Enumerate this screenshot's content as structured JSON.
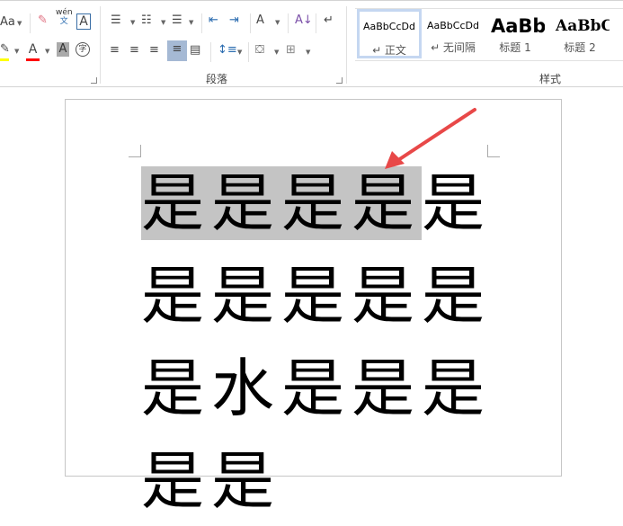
{
  "ribbon": {
    "font_group": {
      "change_case": "Aa",
      "phonetic_top": "wén",
      "phonetic_bottom": "文",
      "char_border": "A",
      "font_color": "A",
      "char_shading": "A",
      "enclose_char": "字"
    },
    "paragraph_group": {
      "label": "段落"
    },
    "styles_group": {
      "label": "样式",
      "items": [
        {
          "preview": "AaBbCcDd",
          "name": "↵ 正文",
          "selected": true
        },
        {
          "preview": "AaBbCcDd",
          "name": "↵ 无间隔"
        },
        {
          "preview": "AaBb",
          "name": "标题 1"
        },
        {
          "preview": "AaBbC",
          "name": "标题 2"
        }
      ]
    }
  },
  "colors": {
    "highlight": "#ffff00",
    "font_color": "#ff0000",
    "selection": "#c4c4c4",
    "arrow": "#e84848"
  },
  "document": {
    "lines": [
      {
        "selected": "是是是是",
        "rest": "是"
      },
      {
        "selected": "",
        "rest": "是是是是是"
      },
      {
        "selected": "",
        "rest": "是水是是是"
      },
      {
        "selected": "",
        "rest": "是是"
      }
    ]
  }
}
